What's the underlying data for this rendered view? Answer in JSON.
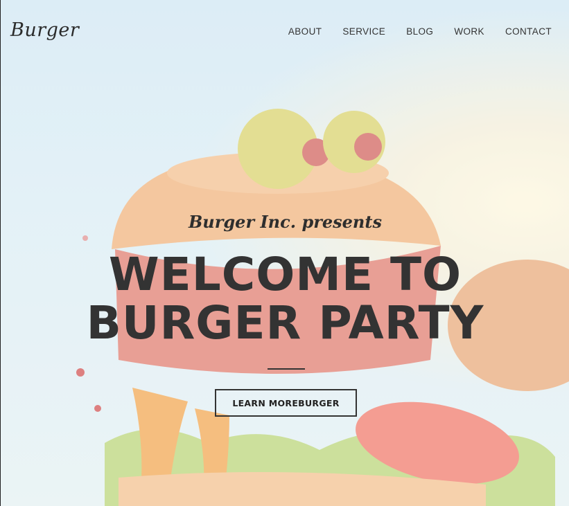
{
  "brand": {
    "logo": "Burger"
  },
  "nav": {
    "items": [
      {
        "label": "ABOUT"
      },
      {
        "label": "SERVICE"
      },
      {
        "label": "BLOG"
      },
      {
        "label": "WORK"
      },
      {
        "label": "CONTACT"
      }
    ]
  },
  "hero": {
    "tagline": "Burger Inc. presents",
    "headline_line1": "WELCOME TO",
    "headline_line2": "BURGER PARTY",
    "cta_label": "LEARN MOREBURGER"
  }
}
